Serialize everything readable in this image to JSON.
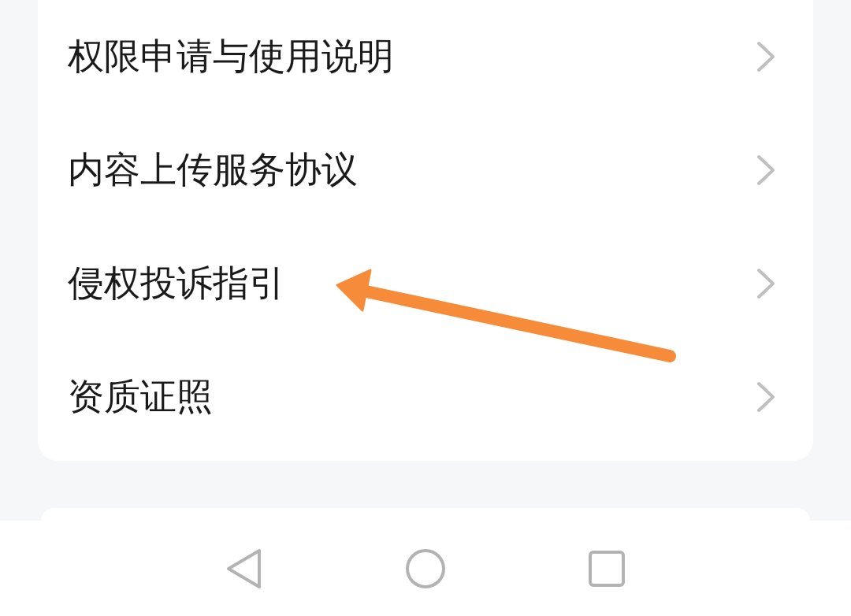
{
  "settings_list": {
    "items": [
      {
        "label": "权限申请与使用说明"
      },
      {
        "label": "内容上传服务协议"
      },
      {
        "label": "侵权投诉指引"
      },
      {
        "label": "资质证照"
      }
    ]
  },
  "navigation_bar": {
    "buttons": [
      {
        "kind": "back"
      },
      {
        "kind": "home"
      },
      {
        "kind": "recents"
      }
    ]
  }
}
